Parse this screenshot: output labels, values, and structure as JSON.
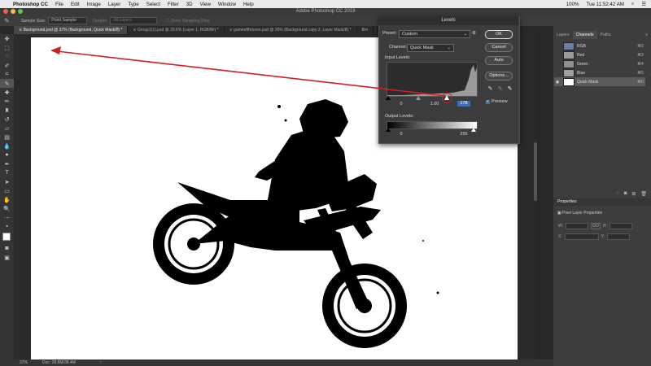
{
  "menubar": {
    "apple": "",
    "app": "Photoshop CC",
    "items": [
      "File",
      "Edit",
      "Image",
      "Layer",
      "Type",
      "Select",
      "Filter",
      "3D",
      "View",
      "Window",
      "Help"
    ],
    "battery": "100%",
    "clock": "Tue 11:52:42 AM"
  },
  "window_title": "Adobe Photoshop CC 2019",
  "options_bar": {
    "sample_size_label": "Sample Size:",
    "sample_size_value": "Point Sample",
    "sample_label": "Sample:",
    "sample_value": "All Layers",
    "show_ring": "Show Sampling Ring"
  },
  "tabs": [
    {
      "label": "Background.psd @ 37% (Background, Quick Mask/8) *",
      "active": true
    },
    {
      "label": "Group1(1).psd @ 29.6% (Layer 1, RGB/8#) *",
      "active": false
    },
    {
      "label": "gameofthrones.psd @ 20% (Background copy 2, Layer Mask/8) *",
      "active": false
    },
    {
      "label": "Bre",
      "active": false
    }
  ],
  "status": {
    "zoom": "37%",
    "doc": "Doc: 28.8M/38.4M"
  },
  "levels": {
    "title": "Levels",
    "preset_label": "Preset:",
    "preset_value": "Custom",
    "channel_label": "Channel:",
    "channel_value": "Quick Mask",
    "input_label": "Input Levels:",
    "input_black": "0",
    "input_gamma": "1.00",
    "input_white": "178",
    "output_label": "Output Levels:",
    "output_black": "0",
    "output_white": "255",
    "ok": "OK",
    "cancel": "Cancel",
    "auto": "Auto",
    "options": "Options...",
    "preview": "Preview",
    "preview_checked": true
  },
  "panels": {
    "tabs": [
      "Layers",
      "Channels",
      "Paths"
    ],
    "active_tab": "Channels",
    "channels": [
      {
        "name": "RGB",
        "shortcut": "⌘2",
        "visible": false
      },
      {
        "name": "Red",
        "shortcut": "⌘3",
        "visible": false
      },
      {
        "name": "Green",
        "shortcut": "⌘4",
        "visible": false
      },
      {
        "name": "Blue",
        "shortcut": "⌘5",
        "visible": false
      },
      {
        "name": "Quick Mask",
        "shortcut": "⌘6",
        "visible": true,
        "selected": true
      }
    ],
    "properties_title": "Properties",
    "properties_sub": "Pixel Layer Properties",
    "w_label": "W:",
    "h_label": "H:",
    "x_label": "X:",
    "y_label": "Y:",
    "go_label": "GO"
  },
  "colors": {
    "accent": "#d0201f",
    "selection_blue": "#3e6fb0"
  }
}
